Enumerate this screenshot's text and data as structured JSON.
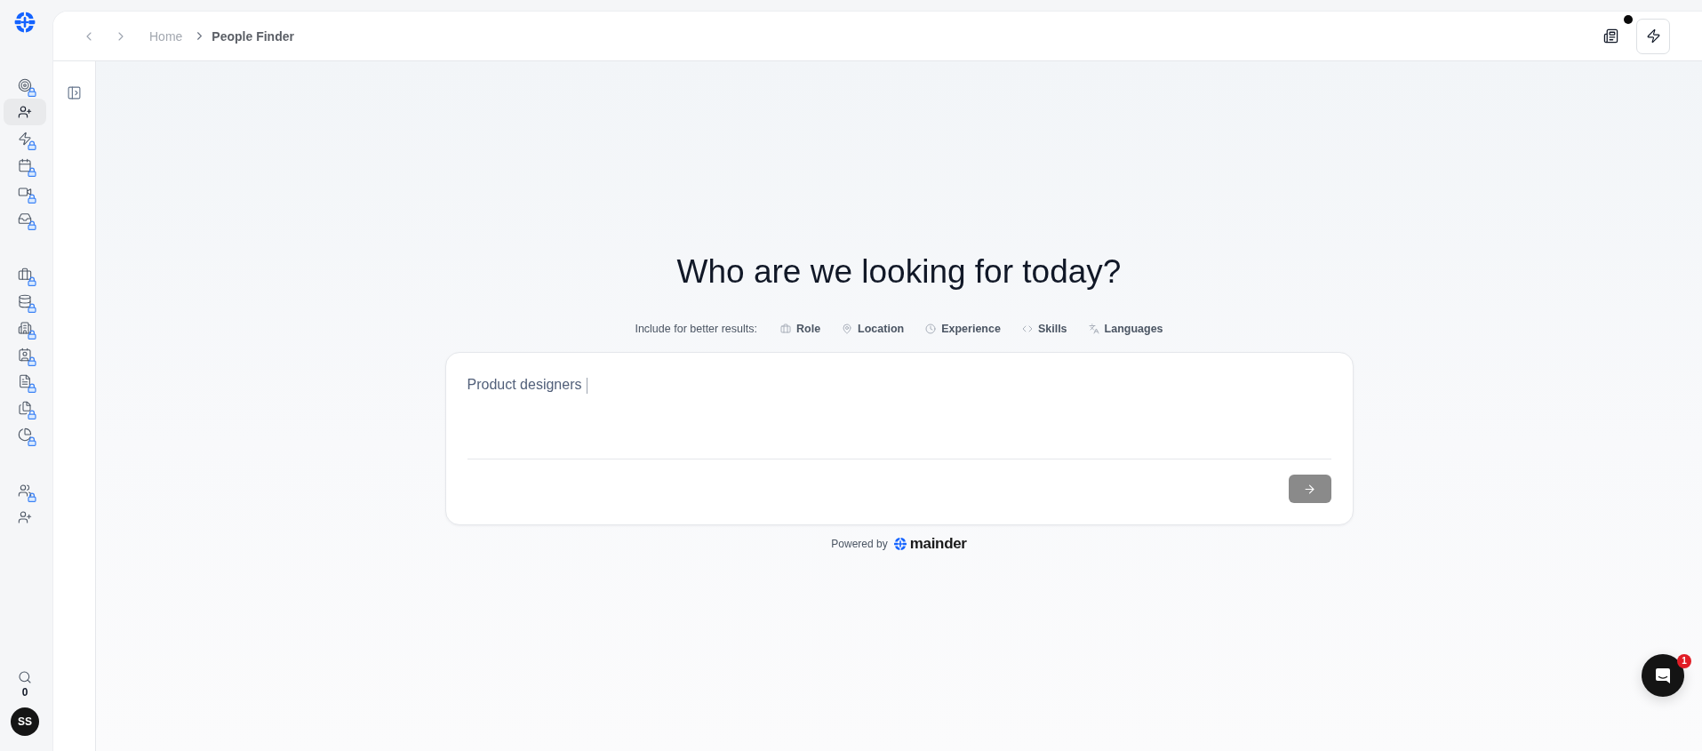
{
  "rail": {
    "groups": [
      {
        "items": [
          {
            "selected": false,
            "locked": true
          },
          {
            "selected": true,
            "locked": false
          },
          {
            "selected": false,
            "locked": true
          },
          {
            "selected": false,
            "locked": true
          },
          {
            "selected": false,
            "locked": true
          },
          {
            "selected": false,
            "locked": true
          }
        ]
      },
      {
        "items": [
          {
            "selected": false,
            "locked": true
          },
          {
            "selected": false,
            "locked": true
          },
          {
            "selected": false,
            "locked": true
          },
          {
            "selected": false,
            "locked": true
          },
          {
            "selected": false,
            "locked": true
          },
          {
            "selected": false,
            "locked": true
          },
          {
            "selected": false,
            "locked": true
          }
        ]
      },
      {
        "items": [
          {
            "selected": false,
            "locked": true
          },
          {
            "selected": false,
            "locked": false
          }
        ]
      }
    ],
    "search_count": "0",
    "avatar": "SS"
  },
  "topbar": {
    "breadcrumb": [
      {
        "label": "Home",
        "current": false
      },
      {
        "label": "People Finder",
        "current": true
      }
    ],
    "news_unread": true
  },
  "hero": {
    "title": "Who are we looking for today?",
    "hint_label": "Include for better results:",
    "hints": [
      {
        "label": "Role"
      },
      {
        "label": "Location"
      },
      {
        "label": "Experience"
      },
      {
        "label": "Skills"
      },
      {
        "label": "Languages"
      }
    ]
  },
  "search": {
    "value": "Product designers",
    "send_disabled": true
  },
  "footer": {
    "powered_by": "Powered by",
    "brand": "mainder"
  },
  "chat": {
    "badge": "1"
  }
}
